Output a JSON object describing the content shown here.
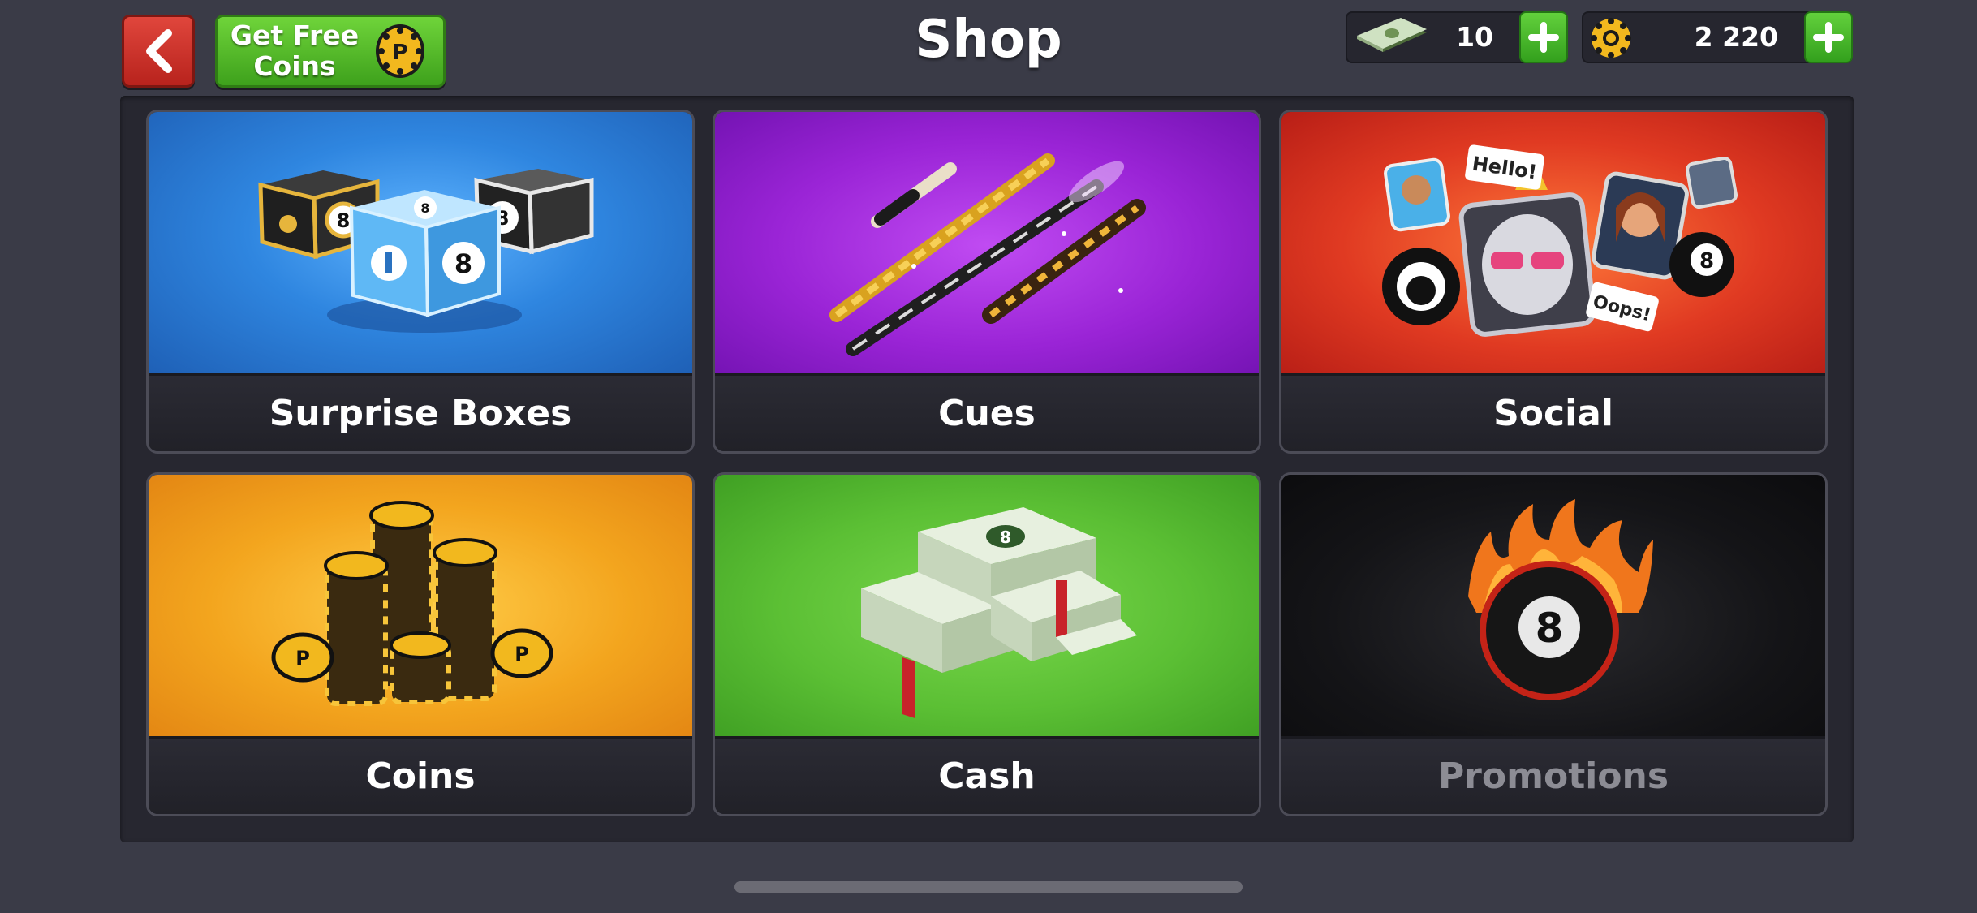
{
  "header": {
    "title": "Shop",
    "back_icon": "chevron-left-icon",
    "free_coins_label_line1": "Get Free",
    "free_coins_label_line2": "Coins",
    "cash_amount": "10",
    "coins_amount": "2 220"
  },
  "tiles": [
    {
      "label": "Surprise Boxes"
    },
    {
      "label": "Cues"
    },
    {
      "label": "Social"
    },
    {
      "label": "Coins"
    },
    {
      "label": "Cash"
    },
    {
      "label": "Promotions"
    }
  ],
  "social_bubbles": {
    "hello": "Hello!",
    "oops": "Oops!"
  },
  "colors": {
    "back_button": "#d33a30",
    "free_coins_button": "#53bd2b",
    "surprise_boxes_bg": "#2f86e0",
    "cues_bg": "#9a24d6",
    "social_bg": "#e03a22",
    "coins_bg": "#f3a51e",
    "cash_bg": "#5bbf34",
    "promotions_bg": "#141417"
  }
}
